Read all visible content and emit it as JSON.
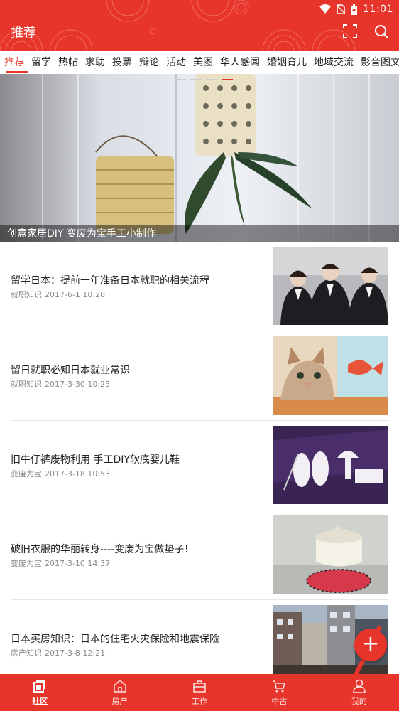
{
  "status_bar": {
    "time": "11:01"
  },
  "app_bar": {
    "title": "推荐"
  },
  "tabs": [
    {
      "label": "推荐",
      "active": true
    },
    {
      "label": "留学"
    },
    {
      "label": "热帖"
    },
    {
      "label": "求助"
    },
    {
      "label": "投票"
    },
    {
      "label": "辩论"
    },
    {
      "label": "活动"
    },
    {
      "label": "美图"
    },
    {
      "label": "华人感闻"
    },
    {
      "label": "婚姻育儿"
    },
    {
      "label": "地域交流"
    },
    {
      "label": "影音图文"
    }
  ],
  "banner": {
    "caption": "创意家居DIY 变废为宝手工小制作"
  },
  "articles": [
    {
      "title": "留学日本：提前一年准备日本就职的相关流程",
      "category": "就职知识",
      "date": "2017-6-1 10:28"
    },
    {
      "title": "留日就职必知日本就业常识",
      "category": "就职知识",
      "date": "2017-3-30 10:25"
    },
    {
      "title": "旧牛仔裤废物利用 手工DIY软底婴儿鞋",
      "category": "变废为宝",
      "date": "2017-3-18 10:53"
    },
    {
      "title": "破旧衣服的华丽转身----变废为宝做垫子！",
      "category": "变废为宝",
      "date": "2017-3-10 14:37"
    },
    {
      "title": "日本买房知识：日本的住宅火灾保险和地震保险",
      "category": "房产知识",
      "date": "2017-3-8 12:21"
    }
  ],
  "fab": {
    "label": "+"
  },
  "bottom_nav": [
    {
      "label": "社区",
      "icon": "community-icon",
      "active": true
    },
    {
      "label": "房产",
      "icon": "home-icon"
    },
    {
      "label": "工作",
      "icon": "briefcase-icon"
    },
    {
      "label": "中古",
      "icon": "cart-icon"
    },
    {
      "label": "我的",
      "icon": "person-icon"
    }
  ],
  "colors": {
    "accent": "#e8352b"
  }
}
